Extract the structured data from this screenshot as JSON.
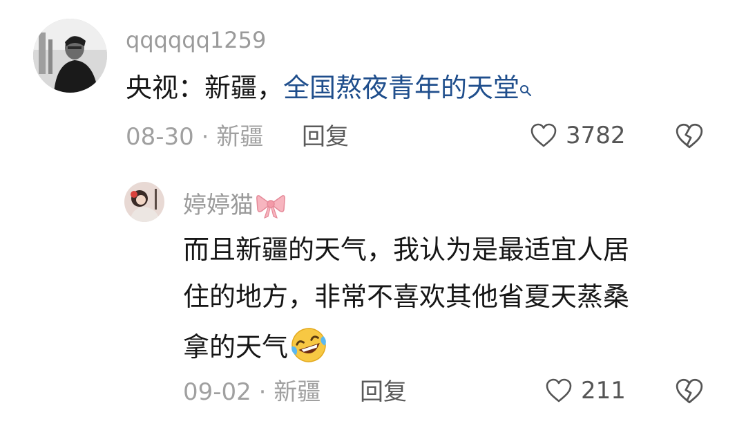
{
  "comments": [
    {
      "username": "qqqqqq1259",
      "text_prefix": "央视：新疆，",
      "text_link": "全国熬夜青年的天堂",
      "date": "08-30",
      "separator": " · ",
      "location": "新疆",
      "reply_label": "回复",
      "like_count": "3782",
      "icons": {
        "like": "heart-icon",
        "dislike": "broken-heart-icon",
        "link": "search-icon"
      }
    }
  ],
  "replies": [
    {
      "username": "婷婷猫",
      "username_badge": "bow-emoji",
      "text_line1": "而且新疆的天气，我认为是最适宜人居",
      "text_line2": "住的地方，非常不喜欢其他省夏天蒸桑",
      "text_line3": "拿的天气",
      "text_emoji": "laughing-crying-emoji",
      "date": "09-02",
      "separator": " · ",
      "location": "新疆",
      "reply_label": "回复",
      "like_count": "211"
    }
  ],
  "colors": {
    "link": "#1f4e8c",
    "username": "#9a9a9a",
    "meta": "#a0a0a0",
    "text": "#161616"
  }
}
